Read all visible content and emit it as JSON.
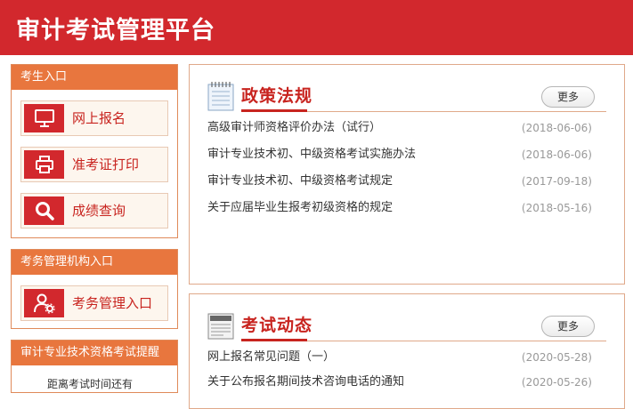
{
  "header": {
    "title": "审计考试管理平台"
  },
  "sidebar": {
    "candidate": {
      "heading": "考生入口",
      "items": [
        {
          "label": "网上报名",
          "icon": "monitor-icon"
        },
        {
          "label": "准考证打印",
          "icon": "printer-icon"
        },
        {
          "label": "成绩查询",
          "icon": "search-icon"
        }
      ]
    },
    "admin": {
      "heading": "考务管理机构入口",
      "items": [
        {
          "label": "考务管理入口",
          "icon": "user-gear-icon"
        }
      ]
    },
    "remind": {
      "heading": "审计专业技术资格考试提醒",
      "item": "距离考试时间还有"
    }
  },
  "panels": [
    {
      "title": "政策法规",
      "icon": "notebook-icon",
      "more": "更多",
      "items": [
        {
          "title": "高级审计师资格评价办法（试行）",
          "date": "(2018-06-06)"
        },
        {
          "title": "审计专业技术初、中级资格考试实施办法",
          "date": "(2018-06-06)"
        },
        {
          "title": "审计专业技术初、中级资格考试规定",
          "date": "(2017-09-18)"
        },
        {
          "title": "关于应届毕业生报考初级资格的规定",
          "date": "(2018-05-16)"
        }
      ]
    },
    {
      "title": "考试动态",
      "icon": "news-icon",
      "more": "更多",
      "items": [
        {
          "title": "网上报名常见问题（一）",
          "date": "(2020-05-28)"
        },
        {
          "title": "关于公布报名期间技术咨询电话的通知",
          "date": "(2020-05-26)"
        }
      ]
    }
  ],
  "colors": {
    "brand_red": "#d2282d",
    "accent_orange": "#e8763e"
  }
}
